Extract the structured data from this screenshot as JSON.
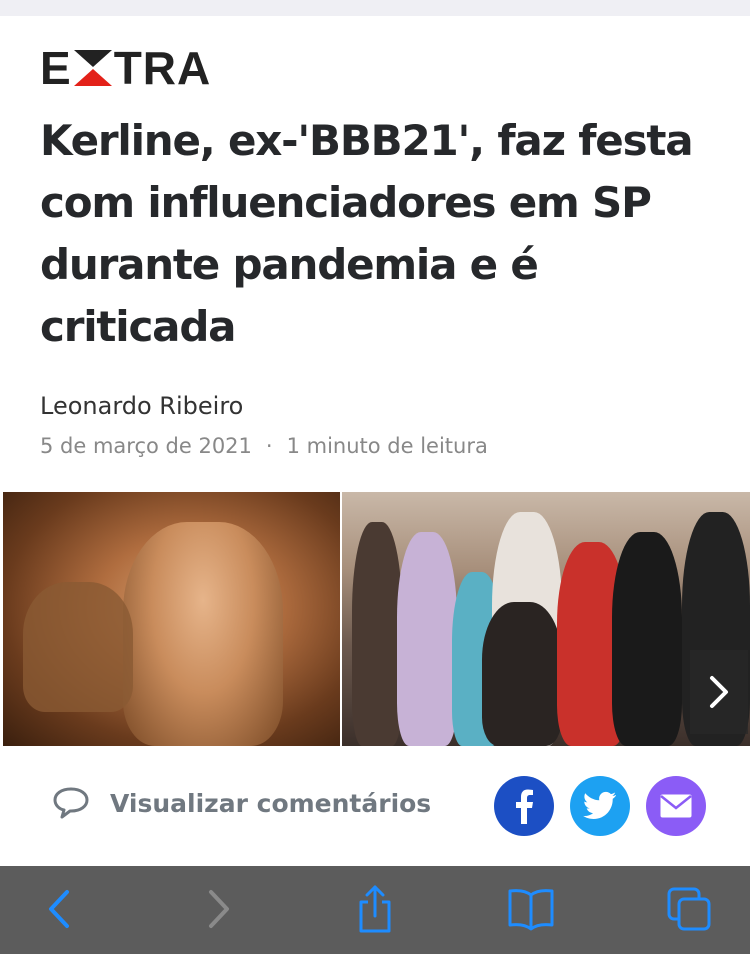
{
  "site": {
    "logo_left": "E",
    "logo_right": "TRA"
  },
  "article": {
    "headline": "Kerline, ex-'BBB21', faz festa com influenciadores em SP durante pandemia e é criticada",
    "author": "Leonardo Ribeiro",
    "date": "5 de março de 2021",
    "separator": "·",
    "reading_time": "1 minuto de leitura"
  },
  "gallery": {
    "next_icon": "chevron-right-icon"
  },
  "actions": {
    "comments_label": "Visualizar comentários",
    "comments_icon": "speech-bubble-icon",
    "share": [
      {
        "icon": "facebook-icon",
        "color": "#1c4fc4"
      },
      {
        "icon": "twitter-icon",
        "color": "#1da1f2"
      },
      {
        "icon": "mail-icon",
        "color": "#8b5cf6"
      }
    ]
  },
  "browser_toolbar": {
    "accent": "#1e8cff",
    "items": [
      "back-icon",
      "forward-icon",
      "share-icon",
      "bookmarks-icon",
      "tabs-icon"
    ]
  }
}
